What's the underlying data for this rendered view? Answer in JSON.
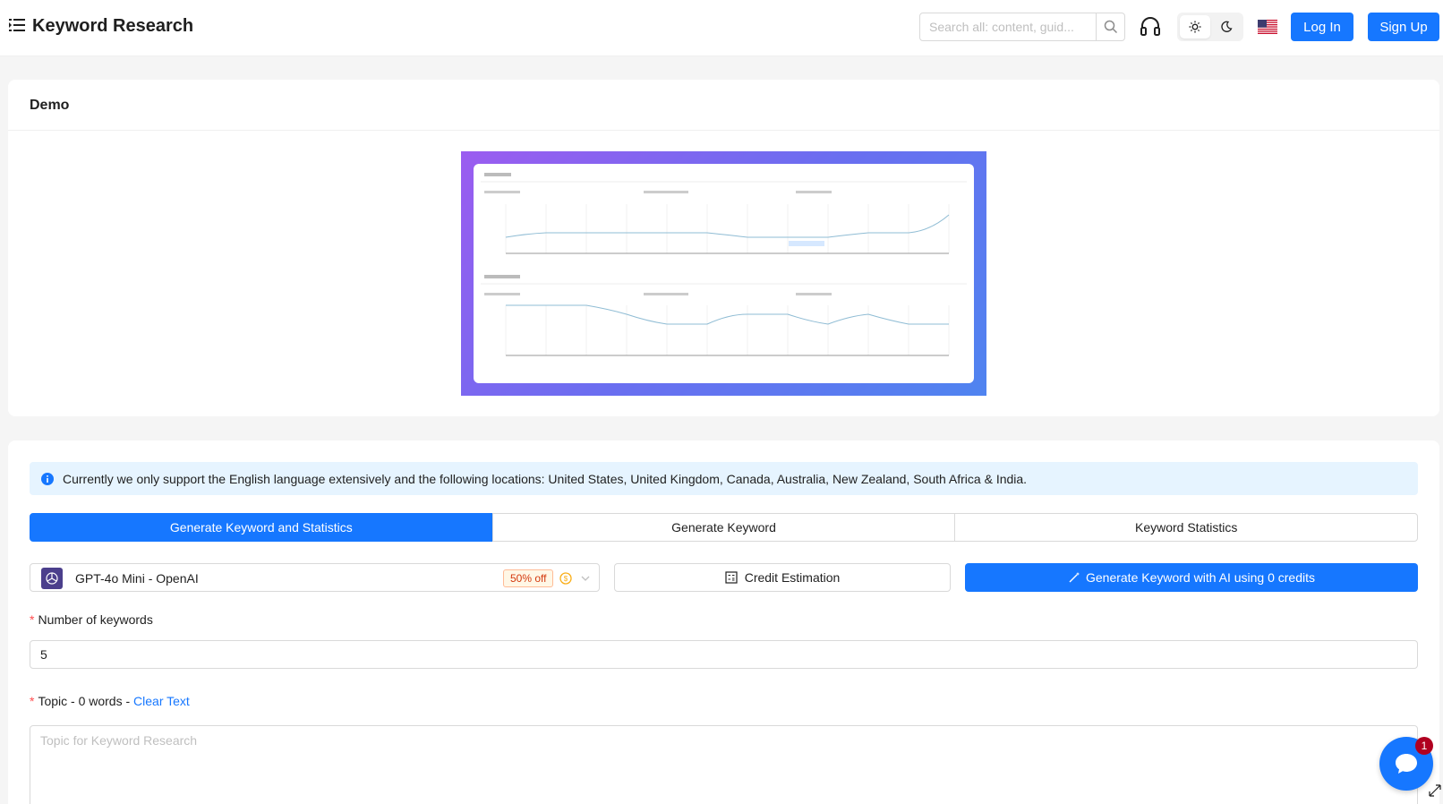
{
  "header": {
    "title": "Keyword Research",
    "search_placeholder": "Search all: content, guid...",
    "login_label": "Log In",
    "signup_label": "Sign Up"
  },
  "demo": {
    "title": "Demo"
  },
  "form": {
    "info_text": "Currently we only support the English language extensively and the following locations: United States, United Kingdom, Canada, Australia, New Zealand, South Africa & India.",
    "tabs": [
      {
        "label": "Generate Keyword and Statistics",
        "active": true
      },
      {
        "label": "Generate Keyword",
        "active": false
      },
      {
        "label": "Keyword Statistics",
        "active": false
      }
    ],
    "model": {
      "name": "GPT-4o Mini - OpenAI",
      "discount": "50% off"
    },
    "credit_button": "Credit Estimation",
    "generate_button": "Generate Keyword with AI using 0 credits",
    "num_keywords_label": "Number of keywords",
    "num_keywords_value": "5",
    "topic_label": "Topic - 0 words - ",
    "clear_text": "Clear Text",
    "topic_placeholder": "Topic for Keyword Research"
  },
  "chat": {
    "badge_count": "1"
  },
  "colors": {
    "primary": "#1677ff",
    "info_bg": "#e6f4ff",
    "discount_text": "#d4380d",
    "badge": "#b00020"
  }
}
